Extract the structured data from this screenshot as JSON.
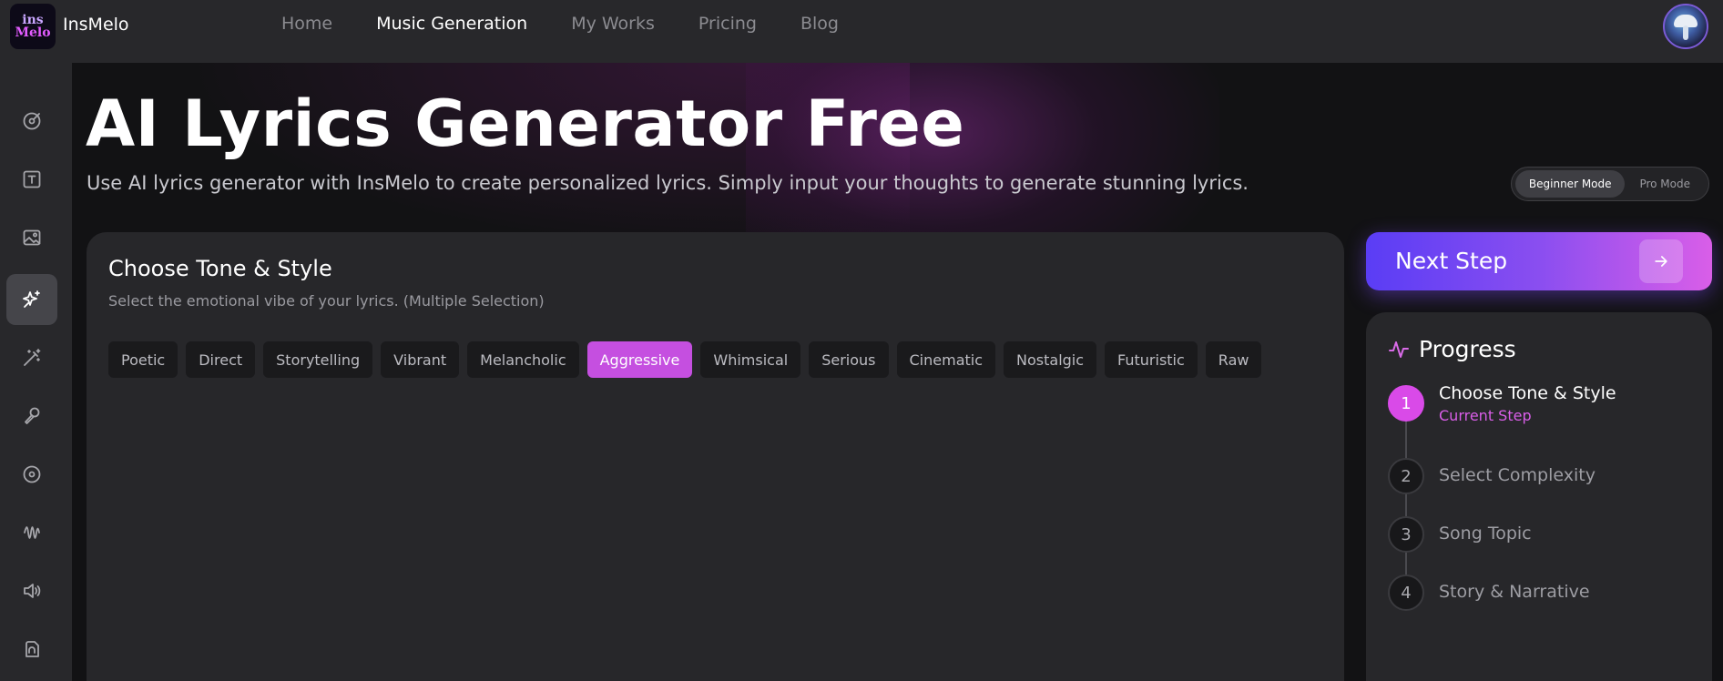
{
  "app": {
    "logo_line1": "ins",
    "logo_line2": "Melo",
    "brand": "InsMelo"
  },
  "nav": {
    "items": [
      {
        "label": "Home",
        "active": false
      },
      {
        "label": "Music Generation",
        "active": true
      },
      {
        "label": "My Works",
        "active": false
      },
      {
        "label": "Pricing",
        "active": false
      },
      {
        "label": "Blog",
        "active": false
      }
    ]
  },
  "sidebar": {
    "icons": [
      "music-disc-icon",
      "text-box-icon",
      "image-icon",
      "sparkles-icon",
      "magic-wand-icon",
      "microphone-icon",
      "vinyl-icon",
      "waveform-icon",
      "speaker-icon",
      "headphones-file-icon"
    ],
    "active_index": 3
  },
  "header": {
    "title": "AI Lyrics Generator Free",
    "subtitle": "Use AI lyrics generator with InsMelo to create personalized lyrics. Simply input your thoughts to generate stunning lyrics."
  },
  "mode": {
    "options": [
      "Beginner Mode",
      "Pro Mode"
    ],
    "selected": "Beginner Mode"
  },
  "tone": {
    "title": "Choose Tone & Style",
    "subtitle": "Select the emotional vibe of your lyrics. (Multiple Selection)",
    "options": [
      "Poetic",
      "Direct",
      "Storytelling",
      "Vibrant",
      "Melancholic",
      "Aggressive",
      "Whimsical",
      "Serious",
      "Cinematic",
      "Nostalgic",
      "Futuristic",
      "Raw"
    ],
    "selected": [
      "Aggressive"
    ]
  },
  "next": {
    "label": "Next Step"
  },
  "progress": {
    "title": "Progress",
    "steps": [
      {
        "number": "1",
        "name": "Choose Tone & Style",
        "status": "Current Step"
      },
      {
        "number": "2",
        "name": "Select Complexity"
      },
      {
        "number": "3",
        "name": "Song Topic"
      },
      {
        "number": "4",
        "name": "Story & Narrative"
      }
    ]
  },
  "colors": {
    "accent": "#d94ae8",
    "chip_selected": "#c54fe0",
    "button_gradient_start": "#5a3df5",
    "button_gradient_end": "#d95ee8",
    "background": "#121214",
    "panel": "#27272a"
  }
}
